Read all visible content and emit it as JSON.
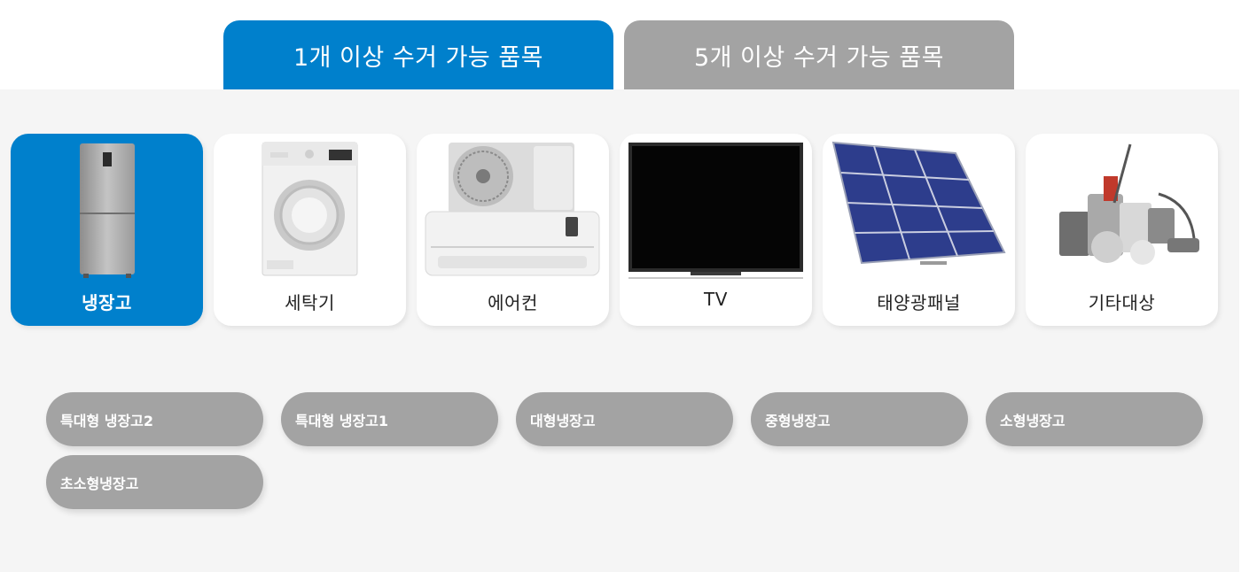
{
  "tabs": [
    {
      "label": "1개 이상 수거 가능 품목",
      "active": true
    },
    {
      "label": "5개 이상 수거 가능 품목",
      "active": false
    }
  ],
  "categories": [
    {
      "label": "냉장고",
      "icon": "refrigerator-icon",
      "selected": true
    },
    {
      "label": "세탁기",
      "icon": "washing-machine-icon",
      "selected": false
    },
    {
      "label": "에어컨",
      "icon": "air-conditioner-icon",
      "selected": false
    },
    {
      "label": "TV",
      "icon": "tv-icon",
      "selected": false
    },
    {
      "label": "태양광패널",
      "icon": "solar-panel-icon",
      "selected": false
    },
    {
      "label": "기타대상",
      "icon": "misc-appliances-icon",
      "selected": false
    }
  ],
  "subtypes": [
    {
      "label": "특대형 냉장고2"
    },
    {
      "label": "특대형 냉장고1"
    },
    {
      "label": "대형냉장고"
    },
    {
      "label": "중형냉장고"
    },
    {
      "label": "소형냉장고"
    },
    {
      "label": "초소형냉장고"
    }
  ],
  "colors": {
    "accent": "#0080cc",
    "inactive": "#a3a3a3",
    "panel_bg": "#f5f5f5"
  }
}
